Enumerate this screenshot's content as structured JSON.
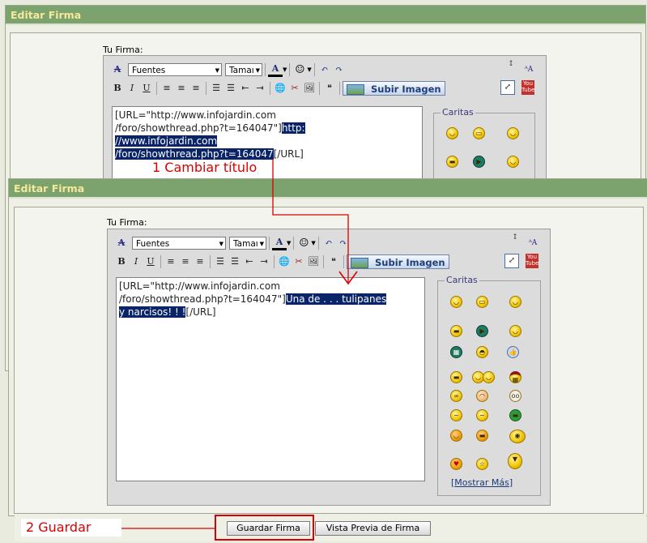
{
  "back_window": {
    "title": "Editar Firma",
    "signature_label": "Tu Firma:",
    "toolbar": {
      "font_select": "Fuentes",
      "size_select": "Tamaı",
      "upload_button": "Subir Imagen"
    },
    "text": {
      "line1": "[URL=\"http://www.infojardin.com",
      "line2a": "/foro/showthread.php?t=164047\"]",
      "line2b": "http:",
      "line3": "//www.infojardin.com",
      "line4a": "/foro/showthread.php?t=164047",
      "line4b": "[/URL]"
    },
    "smilies_legend": "Caritas"
  },
  "front_window": {
    "title": "Editar Firma",
    "signature_label": "Tu Firma:",
    "toolbar": {
      "font_select": "Fuentes",
      "size_select": "Tamaı",
      "upload_button": "Subir Imagen"
    },
    "text": {
      "line1": "[URL=\"http://www.infojardin.com",
      "line2a": "/foro/showthread.php?t=164047\"]",
      "line2b": "Una de . . . tulipanes",
      "line3a": "y narcisos! ! !",
      "line3b": "[/URL]"
    },
    "smilies_legend": "Caritas",
    "more_link": "Mostrar Más",
    "save_button": "Guardar Firma",
    "preview_button": "Vista Previa de Firma"
  },
  "annotations": {
    "step1": "1 Cambiar título",
    "step2": "2   Guardar"
  },
  "colors": {
    "titlebar": "#7ca36d",
    "title_text": "#f7e89c",
    "highlight": "#0a246a",
    "annotation": "#d90000"
  }
}
